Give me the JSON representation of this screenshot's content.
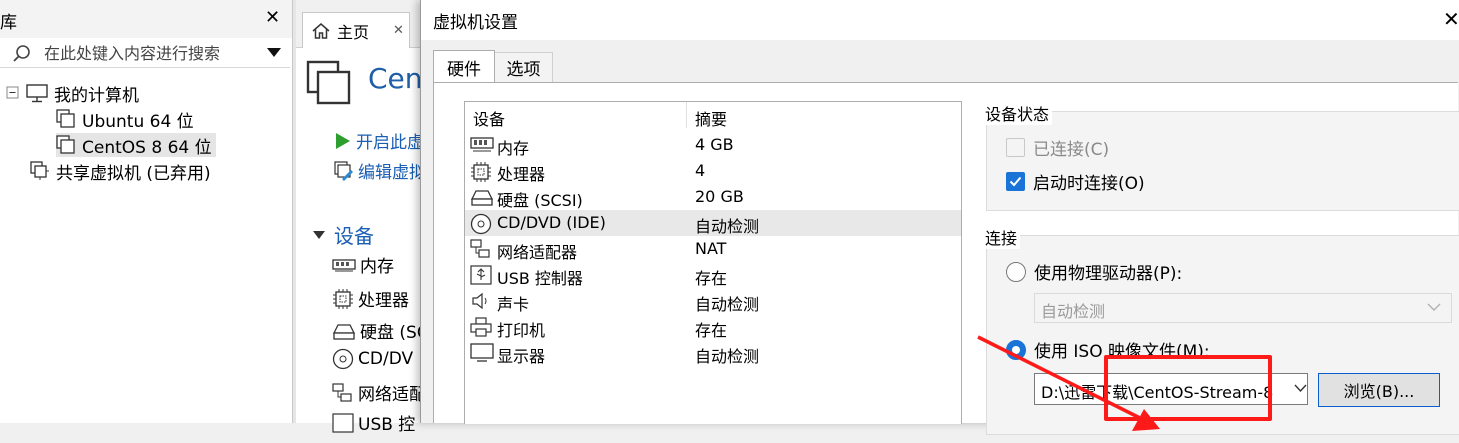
{
  "library": {
    "title": "库",
    "close": "✕",
    "search_placeholder": "在此处键入内容进行搜索",
    "tree": {
      "my_computer": "我的计算机",
      "ubuntu": "Ubuntu 64 位",
      "centos": "CentOS 8 64 位",
      "shared": "共享虚拟机 (已弃用)"
    }
  },
  "main": {
    "home_tab": "主页",
    "home_tab_close": "✕",
    "vm_name_partial": "Cent",
    "start_link_partial": "开启此虚",
    "edit_link_partial": "编辑虚拟",
    "devices_heading": "设备",
    "devices_partial": [
      "内存",
      "处理器",
      "硬盘 (SC",
      "CD/DV",
      "网络适配",
      "USB 控"
    ]
  },
  "dialog": {
    "title": "虚拟机设置",
    "close": "✕",
    "tabs": {
      "hardware": "硬件",
      "options": "选项"
    },
    "device_list": {
      "col_device": "设备",
      "col_summary": "摘要",
      "rows": [
        {
          "name": "内存",
          "summary": "4 GB",
          "icon": "memory-icon"
        },
        {
          "name": "处理器",
          "summary": "4",
          "icon": "processor-icon"
        },
        {
          "name": "硬盘 (SCSI)",
          "summary": "20 GB",
          "icon": "hard-disk-icon"
        },
        {
          "name": "CD/DVD (IDE)",
          "summary": "自动检测",
          "icon": "cd-dvd-icon"
        },
        {
          "name": "网络适配器",
          "summary": "NAT",
          "icon": "network-adapter-icon"
        },
        {
          "name": "USB 控制器",
          "summary": "存在",
          "icon": "usb-icon"
        },
        {
          "name": "声卡",
          "summary": "自动检测",
          "icon": "sound-card-icon"
        },
        {
          "name": "打印机",
          "summary": "存在",
          "icon": "printer-icon"
        },
        {
          "name": "显示器",
          "summary": "自动检测",
          "icon": "display-icon"
        }
      ]
    },
    "device_status": {
      "title": "设备状态",
      "connected_label": "已连接(C)",
      "connect_on_power_label": "启动时连接(O)",
      "connected_checked": false,
      "connect_on_power_checked": true
    },
    "connection": {
      "title": "连接",
      "physical_label": "使用物理驱动器(P):",
      "physical_drive_value": "自动检测",
      "iso_label": "使用 ISO 映像文件(M):",
      "iso_path": "D:\\迅雷下载\\CentOS-Stream-8",
      "browse_label": "浏览(B)...",
      "selected": "iso"
    },
    "colors": {
      "accent": "#1a73d6",
      "annotation": "#ff1a1a"
    }
  }
}
